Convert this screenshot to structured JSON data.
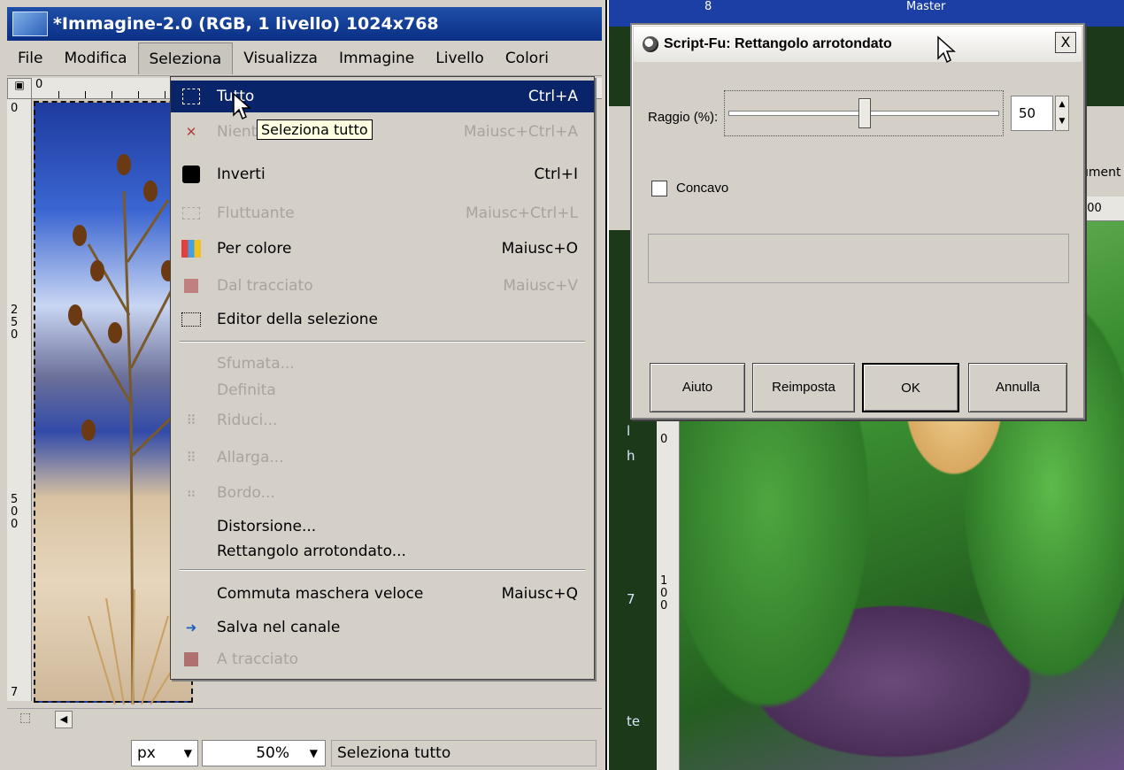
{
  "left_window": {
    "title": "*Immagine-2.0 (RGB, 1 livello) 1024x768",
    "menu": [
      "File",
      "Modifica",
      "Seleziona",
      "Visualizza",
      "Immagine",
      "Livello",
      "Colori"
    ],
    "ruler_top_label": "0",
    "ruler_left_labels": [
      "0",
      "250",
      "500",
      "7"
    ],
    "status": {
      "unit": "px",
      "zoom": "50%",
      "message": "Seleziona tutto"
    }
  },
  "dropdown": {
    "items": [
      {
        "label": "Tutto",
        "shortcut": "Ctrl+A",
        "icon": "select-all-icon",
        "state": "selected"
      },
      {
        "label": "Niente",
        "shortcut": "Maiusc+Ctrl+A",
        "icon": "select-none-icon",
        "state": "disabled"
      },
      {
        "label": "Inverti",
        "shortcut": "Ctrl+I",
        "icon": "invert-icon",
        "state": "normal"
      },
      {
        "label": "Fluttuante",
        "shortcut": "Maiusc+Ctrl+L",
        "icon": "float-icon",
        "state": "disabled"
      },
      {
        "label": "Per colore",
        "shortcut": "Maiusc+O",
        "icon": "by-color-icon",
        "state": "normal"
      },
      {
        "label": "Dal tracciato",
        "shortcut": "Maiusc+V",
        "icon": "from-path-icon",
        "state": "disabled"
      },
      {
        "label": "Editor della selezione",
        "shortcut": "",
        "icon": "selection-editor-icon",
        "state": "normal"
      },
      {
        "label": "Sfumata...",
        "shortcut": "",
        "icon": "",
        "state": "disabled"
      },
      {
        "label": "Definita",
        "shortcut": "",
        "icon": "",
        "state": "disabled"
      },
      {
        "label": "Riduci...",
        "shortcut": "",
        "icon": "shrink-icon",
        "state": "disabled"
      },
      {
        "label": "Allarga...",
        "shortcut": "",
        "icon": "grow-icon",
        "state": "disabled"
      },
      {
        "label": "Bordo...",
        "shortcut": "",
        "icon": "border-icon",
        "state": "disabled"
      },
      {
        "label": "Distorsione...",
        "shortcut": "",
        "icon": "",
        "state": "normal"
      },
      {
        "label": "Rettangolo arrotondato...",
        "shortcut": "",
        "icon": "",
        "state": "normal"
      },
      {
        "label": "Commuta maschera veloce",
        "shortcut": "Maiusc+Q",
        "icon": "",
        "state": "normal"
      },
      {
        "label": "Salva nel canale",
        "shortcut": "",
        "icon": "save-channel-icon",
        "state": "normal"
      },
      {
        "label": "A tracciato",
        "shortcut": "",
        "icon": "to-path-icon",
        "state": "disabled"
      }
    ],
    "tooltip": "Seleziona tutto"
  },
  "right_window": {
    "bg_top_text": "Master",
    "bg_tab_text": "ument",
    "bg_ruler_text": "200",
    "bg_side_labels": [
      "l",
      "h",
      "7",
      "te"
    ],
    "bg_ruler_labels": [
      "0",
      "100"
    ],
    "dialog": {
      "title": "Script-Fu: Rettangolo arrotondato",
      "close": "X",
      "radius_label": "Raggio (%):",
      "radius_value": "50",
      "radius_fraction": 0.5,
      "concave_label": "Concavo",
      "concave_checked": false,
      "buttons": [
        "Aiuto",
        "Reimposta",
        "OK",
        "Annulla"
      ]
    }
  }
}
